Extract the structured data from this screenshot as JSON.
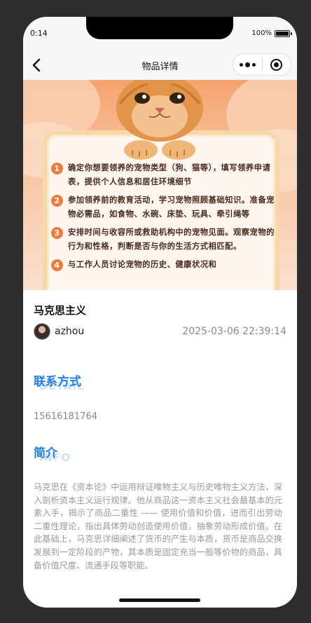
{
  "status": {
    "time": "0:14",
    "battery": "100%"
  },
  "nav": {
    "title": "物品详情"
  },
  "poster": {
    "steps": [
      {
        "num": "1",
        "text": "确定你想要领养的宠物类型（狗、猫等），填写领养申请表，提供个人信息和居住环境细节"
      },
      {
        "num": "2",
        "text": "参加领养前的教育活动，学习宠物照顾基础知识。准备宠物必需品，如食物、水碗、床垫、玩具、牵引绳等"
      },
      {
        "num": "3",
        "text": "安排时间与收容所或救助机构中的宠物见面。观察宠物的行为和性格，判断是否与你的生活方式相匹配。"
      },
      {
        "num": "4",
        "text": "与工作人员讨论宠物的历史、健康状况和"
      }
    ]
  },
  "item": {
    "title": "马克思主义",
    "author": "azhou",
    "date": "2025-03-06 22:39:14"
  },
  "contact": {
    "title": "联系方式",
    "subtitle": "DETAIL",
    "phone": "15616181764"
  },
  "intro": {
    "title": "简介",
    "subtitle": "INFO",
    "text": "马克思在《资本论》中运用辩证唯物主义与历史唯物主义方法，深入剖析资本主义运行规律。他从商品这一资本主义社会最基本的元素入手，揭示了商品二重性 —— 使用价值和价值，进而引出劳动二重性理论，指出具体劳动创造使用价值，抽象劳动形成价值。在此基础上，马克思详细阐述了货币的产生与本质，货币是商品交换发展到一定阶段的产物，其本质是固定充当一般等价物的商品，具备价值尺度、流通手段等职能。"
  }
}
